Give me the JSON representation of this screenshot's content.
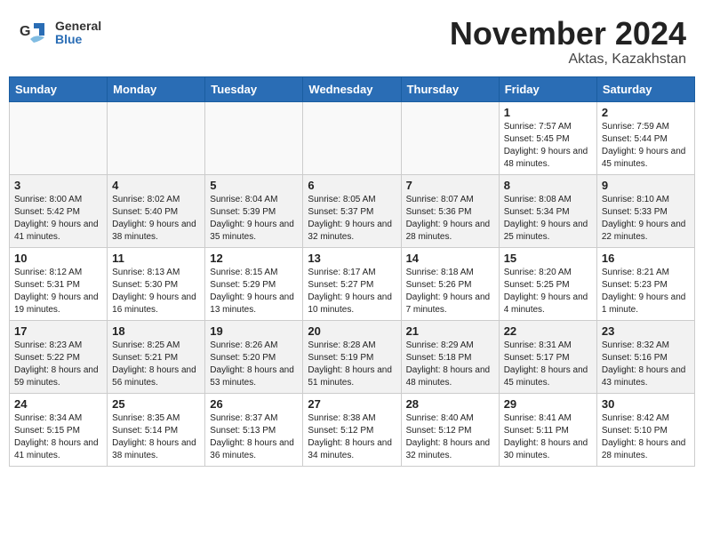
{
  "header": {
    "logo": {
      "general": "General",
      "blue": "Blue"
    },
    "title": "November 2024",
    "location": "Aktas, Kazakhstan"
  },
  "weekdays": [
    "Sunday",
    "Monday",
    "Tuesday",
    "Wednesday",
    "Thursday",
    "Friday",
    "Saturday"
  ],
  "weeks": [
    [
      {
        "day": "",
        "info": ""
      },
      {
        "day": "",
        "info": ""
      },
      {
        "day": "",
        "info": ""
      },
      {
        "day": "",
        "info": ""
      },
      {
        "day": "",
        "info": ""
      },
      {
        "day": "1",
        "info": "Sunrise: 7:57 AM\nSunset: 5:45 PM\nDaylight: 9 hours and 48 minutes."
      },
      {
        "day": "2",
        "info": "Sunrise: 7:59 AM\nSunset: 5:44 PM\nDaylight: 9 hours and 45 minutes."
      }
    ],
    [
      {
        "day": "3",
        "info": "Sunrise: 8:00 AM\nSunset: 5:42 PM\nDaylight: 9 hours and 41 minutes."
      },
      {
        "day": "4",
        "info": "Sunrise: 8:02 AM\nSunset: 5:40 PM\nDaylight: 9 hours and 38 minutes."
      },
      {
        "day": "5",
        "info": "Sunrise: 8:04 AM\nSunset: 5:39 PM\nDaylight: 9 hours and 35 minutes."
      },
      {
        "day": "6",
        "info": "Sunrise: 8:05 AM\nSunset: 5:37 PM\nDaylight: 9 hours and 32 minutes."
      },
      {
        "day": "7",
        "info": "Sunrise: 8:07 AM\nSunset: 5:36 PM\nDaylight: 9 hours and 28 minutes."
      },
      {
        "day": "8",
        "info": "Sunrise: 8:08 AM\nSunset: 5:34 PM\nDaylight: 9 hours and 25 minutes."
      },
      {
        "day": "9",
        "info": "Sunrise: 8:10 AM\nSunset: 5:33 PM\nDaylight: 9 hours and 22 minutes."
      }
    ],
    [
      {
        "day": "10",
        "info": "Sunrise: 8:12 AM\nSunset: 5:31 PM\nDaylight: 9 hours and 19 minutes."
      },
      {
        "day": "11",
        "info": "Sunrise: 8:13 AM\nSunset: 5:30 PM\nDaylight: 9 hours and 16 minutes."
      },
      {
        "day": "12",
        "info": "Sunrise: 8:15 AM\nSunset: 5:29 PM\nDaylight: 9 hours and 13 minutes."
      },
      {
        "day": "13",
        "info": "Sunrise: 8:17 AM\nSunset: 5:27 PM\nDaylight: 9 hours and 10 minutes."
      },
      {
        "day": "14",
        "info": "Sunrise: 8:18 AM\nSunset: 5:26 PM\nDaylight: 9 hours and 7 minutes."
      },
      {
        "day": "15",
        "info": "Sunrise: 8:20 AM\nSunset: 5:25 PM\nDaylight: 9 hours and 4 minutes."
      },
      {
        "day": "16",
        "info": "Sunrise: 8:21 AM\nSunset: 5:23 PM\nDaylight: 9 hours and 1 minute."
      }
    ],
    [
      {
        "day": "17",
        "info": "Sunrise: 8:23 AM\nSunset: 5:22 PM\nDaylight: 8 hours and 59 minutes."
      },
      {
        "day": "18",
        "info": "Sunrise: 8:25 AM\nSunset: 5:21 PM\nDaylight: 8 hours and 56 minutes."
      },
      {
        "day": "19",
        "info": "Sunrise: 8:26 AM\nSunset: 5:20 PM\nDaylight: 8 hours and 53 minutes."
      },
      {
        "day": "20",
        "info": "Sunrise: 8:28 AM\nSunset: 5:19 PM\nDaylight: 8 hours and 51 minutes."
      },
      {
        "day": "21",
        "info": "Sunrise: 8:29 AM\nSunset: 5:18 PM\nDaylight: 8 hours and 48 minutes."
      },
      {
        "day": "22",
        "info": "Sunrise: 8:31 AM\nSunset: 5:17 PM\nDaylight: 8 hours and 45 minutes."
      },
      {
        "day": "23",
        "info": "Sunrise: 8:32 AM\nSunset: 5:16 PM\nDaylight: 8 hours and 43 minutes."
      }
    ],
    [
      {
        "day": "24",
        "info": "Sunrise: 8:34 AM\nSunset: 5:15 PM\nDaylight: 8 hours and 41 minutes."
      },
      {
        "day": "25",
        "info": "Sunrise: 8:35 AM\nSunset: 5:14 PM\nDaylight: 8 hours and 38 minutes."
      },
      {
        "day": "26",
        "info": "Sunrise: 8:37 AM\nSunset: 5:13 PM\nDaylight: 8 hours and 36 minutes."
      },
      {
        "day": "27",
        "info": "Sunrise: 8:38 AM\nSunset: 5:12 PM\nDaylight: 8 hours and 34 minutes."
      },
      {
        "day": "28",
        "info": "Sunrise: 8:40 AM\nSunset: 5:12 PM\nDaylight: 8 hours and 32 minutes."
      },
      {
        "day": "29",
        "info": "Sunrise: 8:41 AM\nSunset: 5:11 PM\nDaylight: 8 hours and 30 minutes."
      },
      {
        "day": "30",
        "info": "Sunrise: 8:42 AM\nSunset: 5:10 PM\nDaylight: 8 hours and 28 minutes."
      }
    ]
  ]
}
